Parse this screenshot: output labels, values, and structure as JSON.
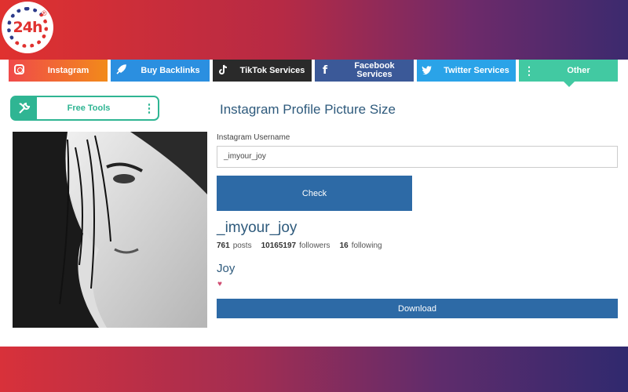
{
  "brand": {
    "logo_text": "24h",
    "registered_mark": "®"
  },
  "nav": {
    "items": [
      {
        "label": "Instagram",
        "icon": "instagram-icon"
      },
      {
        "label": "Buy Backlinks",
        "icon": "rocket-icon"
      },
      {
        "label": "TikTok Services",
        "icon": "tiktok-icon"
      },
      {
        "label": "Facebook Services",
        "icon": "facebook-icon"
      },
      {
        "label": "Twitter Services",
        "icon": "twitter-icon"
      },
      {
        "label": "Other",
        "icon": "kebab-icon"
      }
    ]
  },
  "sidebar": {
    "free_tools_label": "Free Tools",
    "icon": "tools-icon"
  },
  "main": {
    "title": "Instagram Profile Picture Size",
    "username_label": "Instagram Username",
    "username_value": "_imyour_joy",
    "check_label": "Check",
    "profile": {
      "username": "_imyour_joy",
      "posts_count": "761",
      "posts_label": "posts",
      "followers_count": "10165197",
      "followers_label": "followers",
      "following_count": "16",
      "following_label": "following",
      "full_name": "Joy"
    },
    "download_label": "Download"
  },
  "colors": {
    "banner_start": "#e0312f",
    "banner_end": "#3c2a6e",
    "button_blue": "#2d6aa6",
    "title_blue": "#2e5a7c",
    "tools_green": "#2fb593"
  }
}
